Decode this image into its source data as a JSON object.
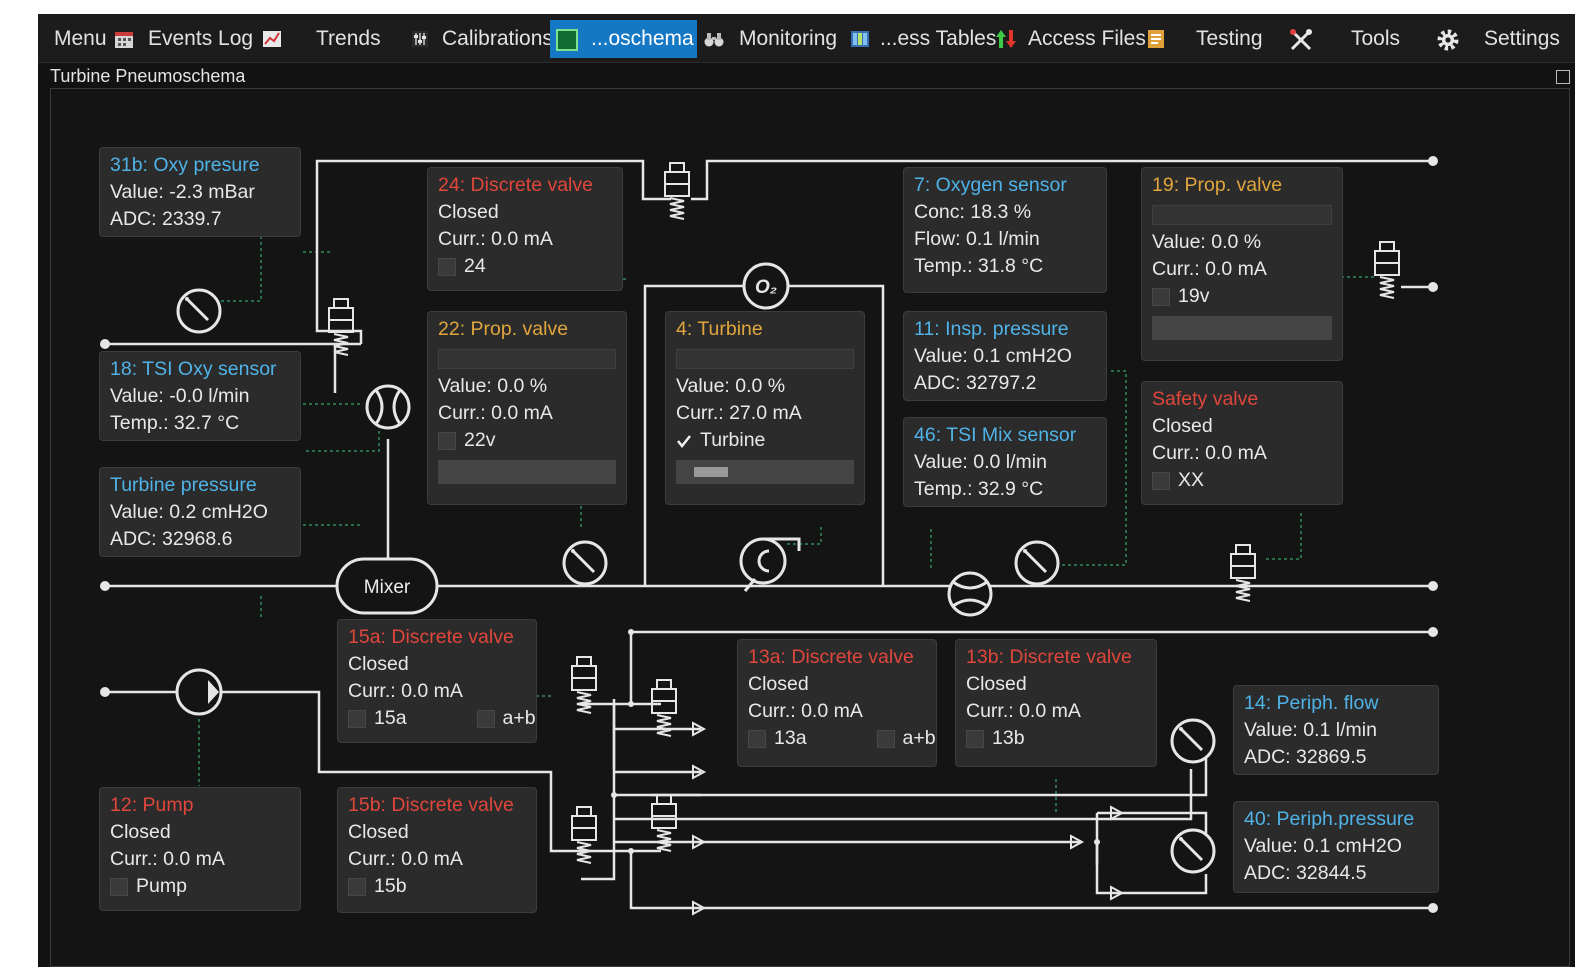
{
  "menu": {
    "menu": "Menu",
    "events_log": "Events Log",
    "trends": "Trends",
    "calibrations": "Calibrations",
    "pneumoschema": "...oschema",
    "monitoring": "Monitoring",
    "access_tables": "...ess Tables",
    "access_files": "Access Files",
    "testing": "Testing",
    "tools": "Tools",
    "settings": "Settings"
  },
  "panel_title": "Turbine Pneumoschema",
  "components": {
    "mixer": "Mixer",
    "oxygen_symbol": "O₂"
  },
  "cards": {
    "c31b": {
      "title": "31b: Oxy presure",
      "line1": "Value: -2.3 mBar",
      "line2": "ADC: 2339.7"
    },
    "c24": {
      "title": "24: Discrete valve",
      "state": "Closed",
      "curr": "Curr.: 0.0 mA",
      "check": "24",
      "checked": false
    },
    "c7": {
      "title": "7: Oxygen sensor",
      "line1": "Conc: 18.3 %",
      "line2": "Flow: 0.1 l/min",
      "line3": "Temp.: 31.8 °C"
    },
    "c19": {
      "title": "19: Prop. valve",
      "value": "Value: 0.0 %",
      "curr": "Curr.: 0.0 mA",
      "check": "19v",
      "checked": false,
      "level": 0
    },
    "c18": {
      "title": "18: TSI Oxy sensor",
      "line1": "Value: -0.0 l/min",
      "line2": "Temp.: 32.7 °C"
    },
    "c22": {
      "title": "22: Prop. valve",
      "value": "Value: 0.0 %",
      "curr": "Curr.: 0.0 mA",
      "check": "22v",
      "checked": false,
      "level": 0
    },
    "c4": {
      "title": "4: Turbine",
      "value": "Value: 0.0 %",
      "curr": "Curr.: 27.0 mA",
      "check": "Turbine",
      "checked": true,
      "level": 0.2
    },
    "c11": {
      "title": "11: Insp. pressure",
      "line1": "Value: 0.1 cmH2O",
      "line2": "ADC: 32797.2"
    },
    "cSafety": {
      "title": "Safety valve",
      "state": "Closed",
      "curr": "Curr.: 0.0 mA",
      "check": "XX",
      "checked": false
    },
    "cTurbP": {
      "title": "Turbine pressure",
      "line1": "Value: 0.2 cmH2O",
      "line2": "ADC: 32968.6"
    },
    "c46": {
      "title": "46: TSI Mix sensor",
      "line1": "Value: 0.0 l/min",
      "line2": "Temp.: 32.9 °C"
    },
    "c15a": {
      "title": "15a: Discrete valve",
      "state": "Closed",
      "curr": "Curr.: 0.0 mA",
      "check": "15a",
      "check2": "a+b"
    },
    "c13a": {
      "title": "13a: Discrete valve",
      "state": "Closed",
      "curr": "Curr.: 0.0 mA",
      "check": "13a",
      "check2": "a+b"
    },
    "c13b": {
      "title": "13b: Discrete valve",
      "state": "Closed",
      "curr": "Curr.: 0.0 mA",
      "check": "13b"
    },
    "c14": {
      "title": "14: Periph. flow",
      "line1": "Value: 0.1 l/min",
      "line2": "ADC: 32869.5"
    },
    "c12": {
      "title": "12: Pump",
      "state": "Closed",
      "curr": "Curr.: 0.0 mA",
      "check": "Pump"
    },
    "c15b": {
      "title": "15b: Discrete valve",
      "state": "Closed",
      "curr": "Curr.: 0.0 mA",
      "check": "15b"
    },
    "c40": {
      "title": "40: Periph.pressure",
      "line1": "Value: 0.1 cmH2O",
      "line2": "ADC: 32844.5"
    }
  },
  "colors": {
    "background": "#141414",
    "card": "#2b2b2b",
    "pipe": "#e6e6e6",
    "link": "#2e8b57",
    "sensor_title": "#4fb3e8",
    "valve_title": "#e0463c",
    "prop_title": "#e0a63c",
    "accent": "#1478c4"
  },
  "icons": [
    "calendar-icon",
    "chart-icon",
    "sliders-icon",
    "schema-icon",
    "binoculars-icon",
    "table-icon",
    "arrows-icon",
    "document-icon",
    "wrench-icon",
    "gear-icon"
  ]
}
